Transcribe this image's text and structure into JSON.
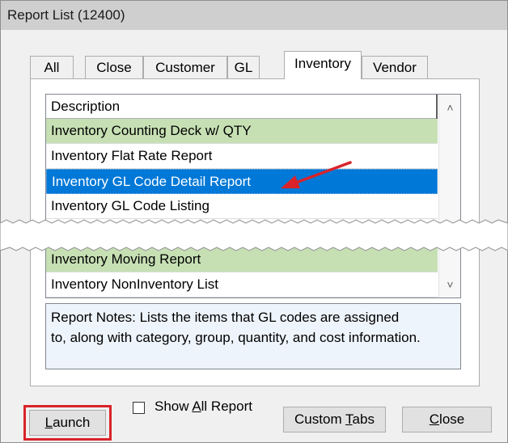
{
  "window": {
    "title": "Report List (12400)"
  },
  "tabs": [
    {
      "label": "All",
      "active": false
    },
    {
      "label": "Close",
      "active": false
    },
    {
      "label": "Customer",
      "active": false
    },
    {
      "label": "GL",
      "active": false
    },
    {
      "label": "Inventory",
      "active": true
    },
    {
      "label": "Vendor",
      "active": false
    }
  ],
  "list": {
    "header": "Description",
    "rows": [
      {
        "label": "Inventory Counting Deck w/ QTY",
        "style": "green"
      },
      {
        "label": "Inventory Flat Rate Report",
        "style": "normal"
      },
      {
        "label": "Inventory GL Code Detail Report",
        "style": "selected"
      },
      {
        "label": "Inventory GL Code Listing",
        "style": "normal"
      },
      {
        "label": "Inventory Moving Report",
        "style": "green"
      },
      {
        "label": "Inventory NonInventory List",
        "style": "normal"
      }
    ]
  },
  "notes": {
    "line1": "Report Notes:  Lists the items that GL codes are assigned",
    "line2": "to, along with category, group, quantity, and cost information."
  },
  "buttons": {
    "launch": "aunch",
    "launch_mnemonic": "L",
    "show_all_prefix": "Show ",
    "show_all_mnemonic": "A",
    "show_all_suffix": "ll Report",
    "show_all_checked": false,
    "custom_tabs_prefix": "Custom ",
    "custom_tabs_mnemonic": "T",
    "custom_tabs_suffix": "abs",
    "close_mnemonic": "C",
    "close_suffix": "lose"
  },
  "colors": {
    "selected_row": "#0078d7",
    "green_row": "#c6e0b4",
    "annotation_red": "#d9232a"
  },
  "icons": {
    "scroll_up": "chevron-up-icon",
    "scroll_down": "chevron-down-icon"
  }
}
